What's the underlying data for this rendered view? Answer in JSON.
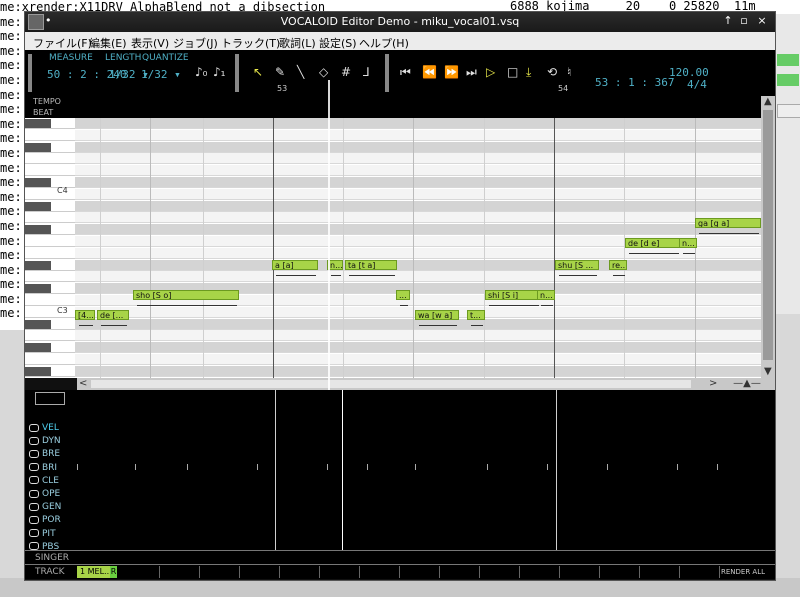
{
  "background_terminal": {
    "top_right": "6888 kojima     20    0 25820  11m",
    "lines": [
      "me:xrender:X11DRV AlphaBlend not a dibsection",
      "me:",
      "me:",
      "me:",
      "me:",
      "me:",
      "me:",
      "me:",
      "me:",
      "me:",
      "me:",
      "me:",
      "me:",
      "me:",
      "me:",
      "me:",
      "me:",
      "me:",
      "me:",
      "me:",
      "me:",
      "me:"
    ]
  },
  "window": {
    "title": "VOCALOID Editor Demo - miku_vocal01.vsq"
  },
  "menu": {
    "items": [
      "ファイル(F)",
      "編集(E)",
      "表示(V)",
      "ジョブ(J)",
      "トラック(T)",
      "歌詞(L)",
      "設定(S)",
      "ヘルプ(H)"
    ]
  },
  "toolbar": {
    "measure_label": "MEASURE",
    "length_label": "LENGTH",
    "quantize_label": "QUANTIZE",
    "measure_value": "50 : 2 : 240",
    "length_value": "1/32 ▾",
    "quantize_value": "1/32 ▾",
    "position": "53 : 1 : 367",
    "tempo": "120.00",
    "signature": "4/4"
  },
  "ruler": {
    "tempo_label": "TEMPO",
    "beat_label": "BEAT",
    "measures": [
      "53",
      "54"
    ]
  },
  "keys": {
    "labels": [
      "C4",
      "C3"
    ]
  },
  "notes": [
    {
      "lyric": "a [a]"
    },
    {
      "lyric": "n..."
    },
    {
      "lyric": "ta [t a]"
    },
    {
      "lyric": "sho [S o]"
    },
    {
      "lyric": "..."
    },
    {
      "lyric": "shi [S i]"
    },
    {
      "lyric": "n..."
    },
    {
      "lyric": "[4..."
    },
    {
      "lyric": "de [..."
    },
    {
      "lyric": "wa [w a]"
    },
    {
      "lyric": "t..."
    },
    {
      "lyric": "shu [S ..."
    },
    {
      "lyric": "re..."
    },
    {
      "lyric": "de [d e]"
    },
    {
      "lyric": "n..."
    },
    {
      "lyric": "ga [g a]"
    }
  ],
  "controls": {
    "items": [
      "VEL",
      "DYN",
      "BRE",
      "BRI",
      "CLE",
      "OPE",
      "GEN",
      "POR",
      "PIT",
      "PBS"
    ],
    "active": "VEL"
  },
  "singer_label": "SINGER",
  "track": {
    "label": "TRACK",
    "active_tab": "1 MEL...",
    "r_badge": "R",
    "render_all": "RENDER ALL"
  }
}
